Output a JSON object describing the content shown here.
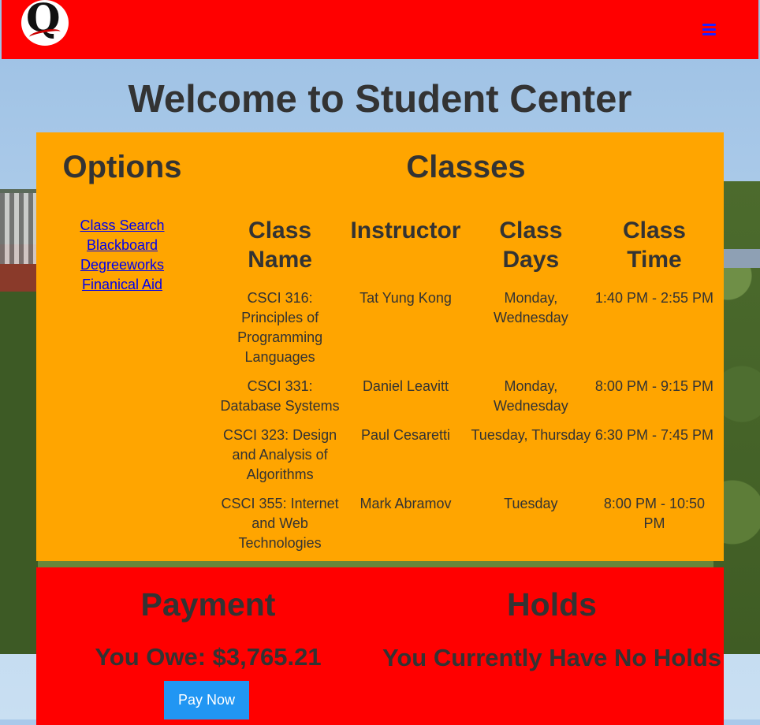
{
  "navbar": {
    "color": "#ff0000",
    "logo_icon": "queens-college-q-logo",
    "menu_icon": "hamburger-menu-icon"
  },
  "page_title": "Welcome to Student Center",
  "options": {
    "title": "Options",
    "links": [
      "Class Search",
      "Blackboard",
      "Degreeworks",
      "Finanical Aid"
    ]
  },
  "classes": {
    "title": "Classes",
    "headers": [
      "Class Name",
      "Instructor",
      "Class Days",
      "Class Time"
    ],
    "rows": [
      [
        "CSCI 316: Principles of Programming Languages",
        "Tat Yung Kong",
        "Monday, Wednesday",
        "1:40 PM - 2:55 PM"
      ],
      [
        "CSCI 331: Database Systems",
        "Daniel Leavitt",
        "Monday, Wednesday",
        "8:00 PM - 9:15 PM"
      ],
      [
        "CSCI 323: Design and Analysis of Algorithms",
        "Paul Cesaretti",
        "Tuesday, Thursday",
        "6:30 PM - 7:45 PM"
      ],
      [
        "CSCI 355: Internet and Web Technologies",
        "Mark Abramov",
        "Tuesday",
        "8:00 PM - 10:50 PM"
      ]
    ]
  },
  "payment": {
    "title": "Payment",
    "amount": "You Owe: $3,765.21",
    "button": "Pay Now",
    "button_color": "#2196f3"
  },
  "holds": {
    "title": "Holds",
    "text": "You Currently Have No Holds"
  },
  "colors": {
    "options_panel": "#ffa500",
    "bottom_panel": "#ff0000"
  }
}
